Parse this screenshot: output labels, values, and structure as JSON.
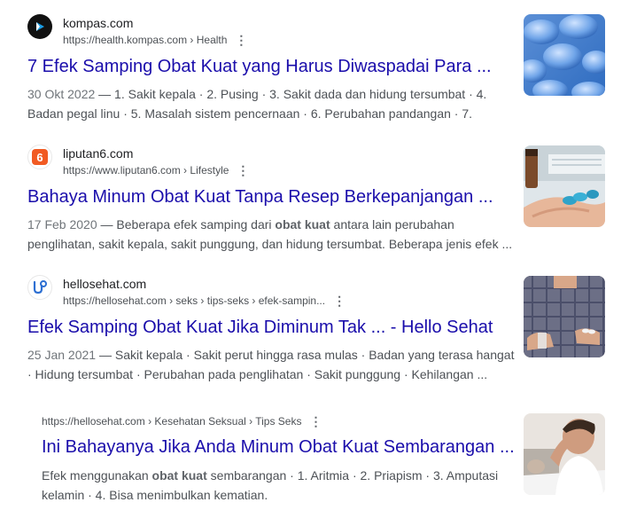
{
  "results": [
    {
      "site_name": "kompas.com",
      "url": "https://health.kompas.com › Health",
      "title": "7 Efek Samping Obat Kuat yang Harus Diwaspadai Para ...",
      "date": "30 Okt 2022",
      "snippet_parts": [
        " — 1. Sakit kepala · 2. Pusing · 3. Sakit dada dan hidung tersumbat · 4. Badan pegal linu · 5. Masalah sistem pencernaan · 6. Perubahan pandangan · 7."
      ],
      "favicon": "kompas-icon",
      "thumbnail": "blue-pills-image"
    },
    {
      "site_name": "liputan6.com",
      "url": "https://www.liputan6.com › Lifestyle",
      "title": "Bahaya Minum Obat Kuat Tanpa Resep Berkepanjangan ...",
      "date": "17 Feb 2020",
      "snippet_pre": " — Beberapa efek samping dari ",
      "snippet_bold": "obat kuat",
      "snippet_post": " antara lain perubahan penglihatan, sakit kepala, sakit punggung, dan hidung tersumbat. Beberapa jenis efek ...",
      "favicon": "liputan6-icon",
      "thumbnail": "pill-in-hand-image"
    },
    {
      "site_name": "hellosehat.com",
      "url": "https://hellosehat.com › seks › tips-seks › efek-sampin...",
      "title": "Efek Samping Obat Kuat Jika Diminum Tak ... - Hello Sehat",
      "date": "25 Jan 2021",
      "snippet": " — Sakit kepala · Sakit perut hingga rasa mulas · Badan yang terasa hangat · Hidung tersumbat · Perubahan pada penglihatan · Sakit punggung · Kehilangan ...",
      "favicon": "hellosehat-icon",
      "thumbnail": "man-with-pills-image"
    },
    {
      "url": "https://hellosehat.com › Kesehatan Seksual › Tips Seks",
      "title": "Ini Bahayanya Jika Anda Minum Obat Kuat Sembarangan ...",
      "snippet_pre": "Efek menggunakan ",
      "snippet_bold": "obat kuat",
      "snippet_post": " sembarangan · 1. Aritmia · 2. Priapism · 3. Amputasi kelamin · 4. Bisa menimbulkan kematian.",
      "thumbnail": "worried-man-image"
    }
  ],
  "kebab_glyph": "⋮",
  "colors": {
    "link": "#1a0dab",
    "text": "#4d5156",
    "liputan_orange": "#f15a22",
    "kompas_blue": "#1b5fa8"
  }
}
